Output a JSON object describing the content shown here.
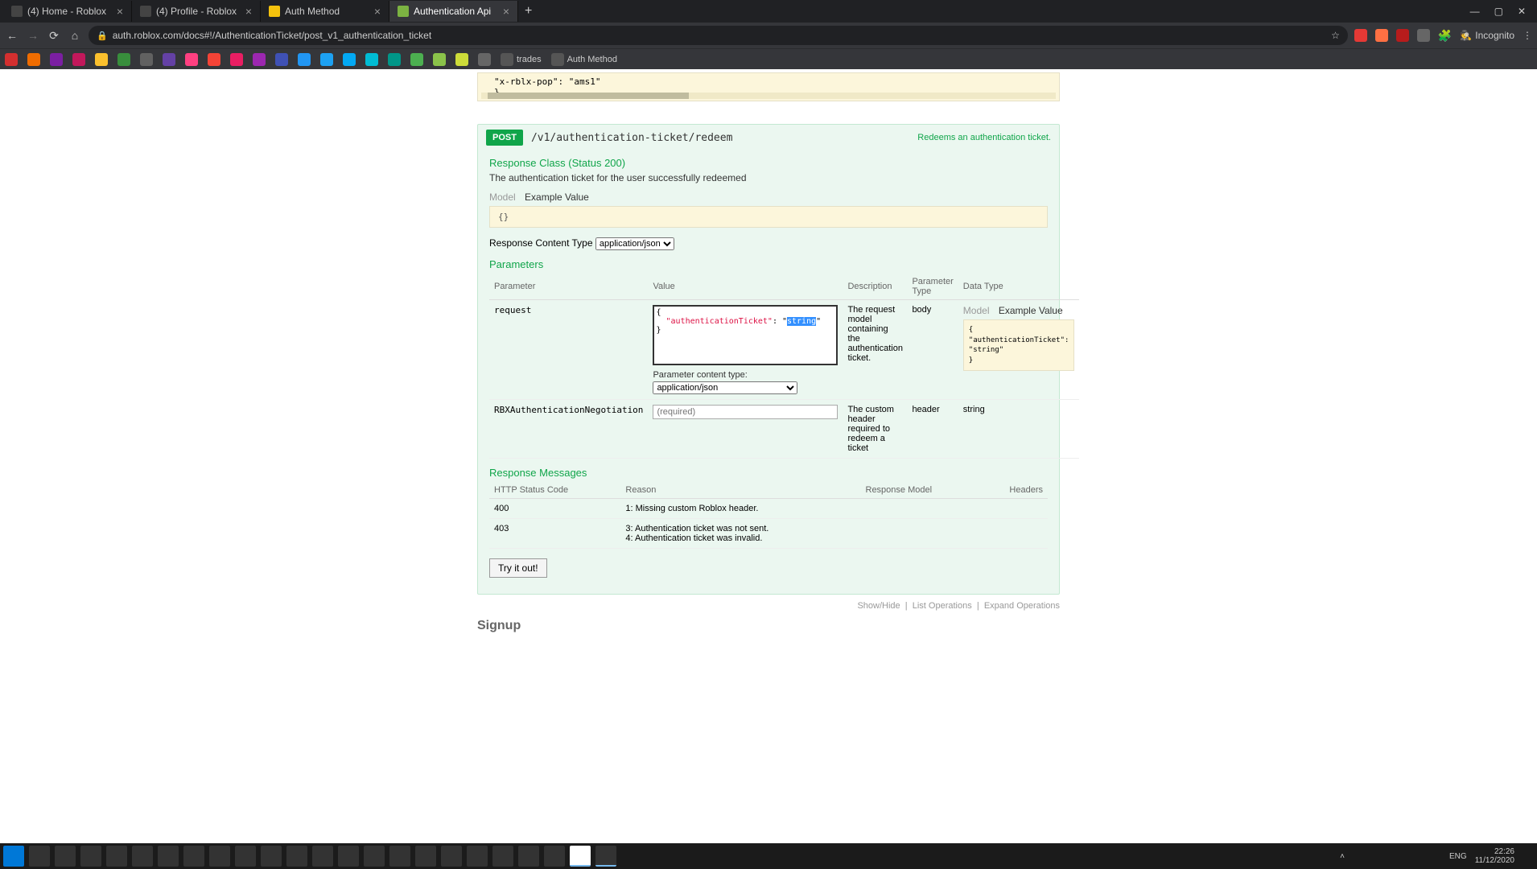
{
  "browser": {
    "tabs": [
      {
        "label": "(4) Home - Roblox"
      },
      {
        "label": "(4) Profile - Roblox"
      },
      {
        "label": "Auth Method"
      },
      {
        "label": "Authentication Api"
      }
    ],
    "url": "auth.roblox.com/docs#!/AuthenticationTicket/post_v1_authentication_ticket",
    "incognito": "Incognito",
    "bookmarks": {
      "trades": "trades",
      "auth": "Auth Method"
    }
  },
  "prev_code": {
    "line1": "\"x-rblx-pop\": \"ams1\"",
    "line2": "}"
  },
  "endpoint": {
    "method": "POST",
    "path": "/v1/authentication-ticket/redeem",
    "summary": "Redeems an authentication ticket."
  },
  "response": {
    "class_label": "Response Class (Status 200)",
    "desc": "The authentication ticket for the user successfully redeemed",
    "tab_model": "Model",
    "tab_example": "Example Value",
    "example_body": "{}"
  },
  "rct": {
    "label": "Response Content Type",
    "value": "application/json"
  },
  "params": {
    "title": "Parameters",
    "headers": {
      "p": "Parameter",
      "v": "Value",
      "d": "Description",
      "pt": "Parameter Type",
      "dt": "Data Type"
    },
    "row1": {
      "name": "request",
      "textarea": "{\n  \"authenticationTicket\": \"string\"\n}",
      "desc": "The request model containing the authentication ticket.",
      "ptype": "body",
      "dt_model": "Model",
      "dt_example": "Example Value",
      "dt_body_l1": "{",
      "dt_body_l2": "  \"authenticationTicket\": \"string\"",
      "dt_body_l3": "}",
      "pct_label": "Parameter content type:",
      "pct_value": "application/json"
    },
    "row2": {
      "name": "RBXAuthenticationNegotiation",
      "placeholder": "(required)",
      "desc": "The custom header required to redeem a ticket",
      "ptype": "header",
      "dtype": "string"
    }
  },
  "resp_msgs": {
    "title": "Response Messages",
    "headers": {
      "c": "HTTP Status Code",
      "r": "Reason",
      "m": "Response Model",
      "h": "Headers"
    },
    "r1": {
      "code": "400",
      "reason": "1: Missing custom Roblox header."
    },
    "r2": {
      "code": "403",
      "reason1": "3: Authentication ticket was not sent.",
      "reason2": "4: Authentication ticket was invalid."
    }
  },
  "try_label": "Try it out!",
  "footer": {
    "sh": "Show/Hide",
    "lo": "List Operations",
    "eo": "Expand Operations"
  },
  "signup": "Signup",
  "taskbar": {
    "time": "22:26",
    "date": "11/12/2020",
    "lang": "ENG"
  }
}
